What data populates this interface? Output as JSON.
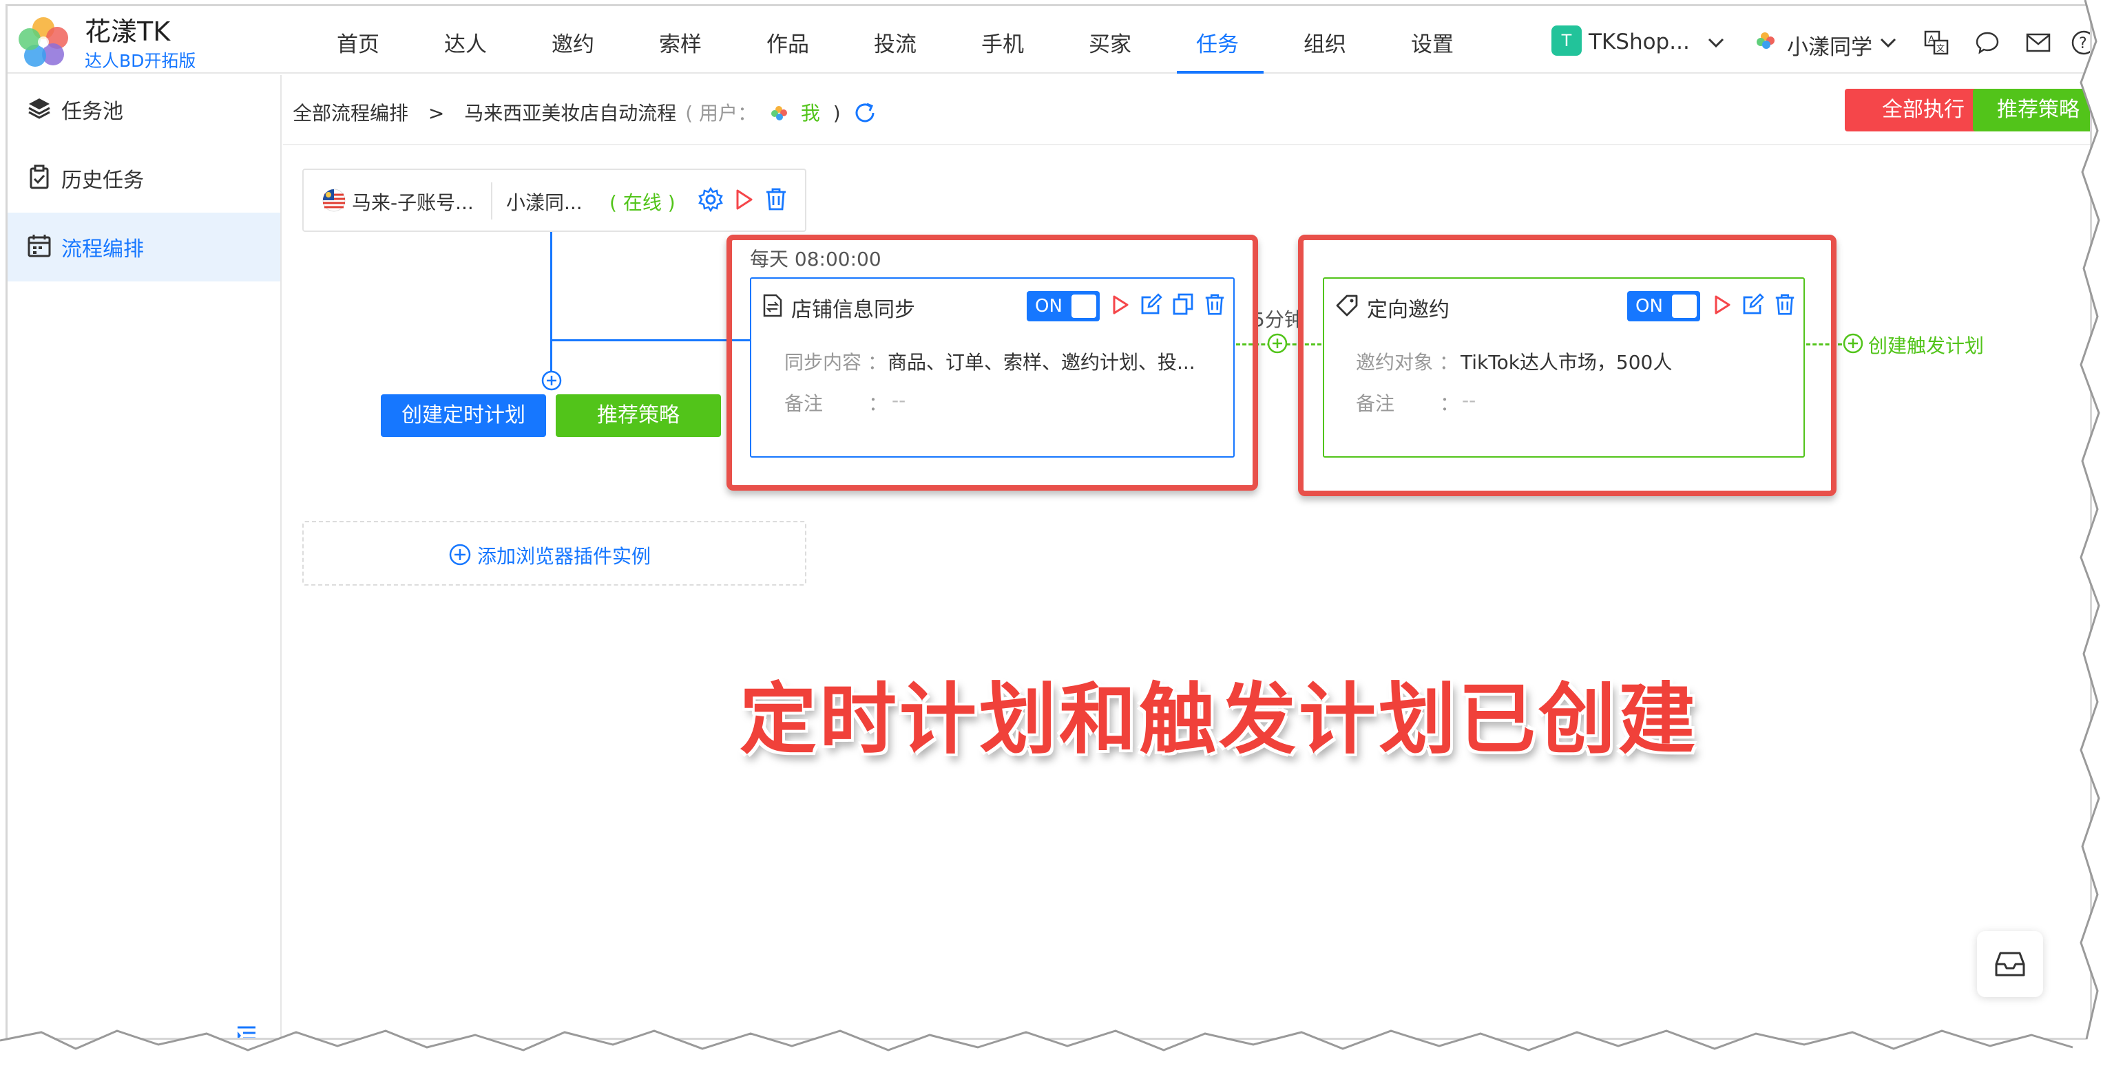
{
  "app": {
    "name": "花漾TK",
    "subtitle": "达人BD开拓版"
  },
  "nav": {
    "items": [
      "首页",
      "达人",
      "邀约",
      "索样",
      "作品",
      "投流",
      "手机",
      "买家",
      "任务",
      "组织",
      "设置"
    ],
    "active": "任务"
  },
  "header": {
    "shop_badge": "T",
    "shop_name": "TKShop...",
    "user_name": "小漾同学"
  },
  "sidebar": {
    "items": [
      {
        "label": "任务池",
        "icon": "layers-icon"
      },
      {
        "label": "历史任务",
        "icon": "clipboard-check-icon"
      },
      {
        "label": "流程编排",
        "icon": "calendar-icon",
        "active": true
      }
    ]
  },
  "breadcrumb": {
    "root": "全部流程编排",
    "separator": ">",
    "current": "马来西亚美妆店自动流程",
    "user_prefix": "( 用户：",
    "user_value": "我",
    "user_suffix": ")"
  },
  "actions": {
    "run_all": "全部执行",
    "recommend": "推荐策略"
  },
  "account_row": {
    "account": "马来-子账号...",
    "browser": "小漾同...",
    "status": "( 在线 )"
  },
  "left_buttons": {
    "create_schedule": "创建定时计划",
    "recommend": "推荐策略"
  },
  "schedule": {
    "time_label": "每天  08:00:00",
    "card": {
      "title": "店铺信息同步",
      "toggle": "ON",
      "field1_label": "同步内容 ：",
      "field1_value": "商品、订单、索样、邀约计划、投...",
      "field2_label": "备注",
      "field2_sep": "：",
      "field2_value": "--"
    }
  },
  "connector": {
    "delay": "5分钟"
  },
  "trigger": {
    "card": {
      "title": "定向邀约",
      "toggle": "ON",
      "field1_label": "邀约对象 ：",
      "field1_value": "TikTok达人市场，500人",
      "field2_label": "备注",
      "field2_sep": "：",
      "field2_value": "--"
    },
    "create_trigger": "创建触发计划"
  },
  "add_plugin": "添加浏览器插件实例",
  "annotation": "定时计划和触发计划已创建",
  "colors": {
    "primary": "#1677ff",
    "success": "#52c41a",
    "danger": "#f5464a",
    "annotation": "#f0413a"
  }
}
